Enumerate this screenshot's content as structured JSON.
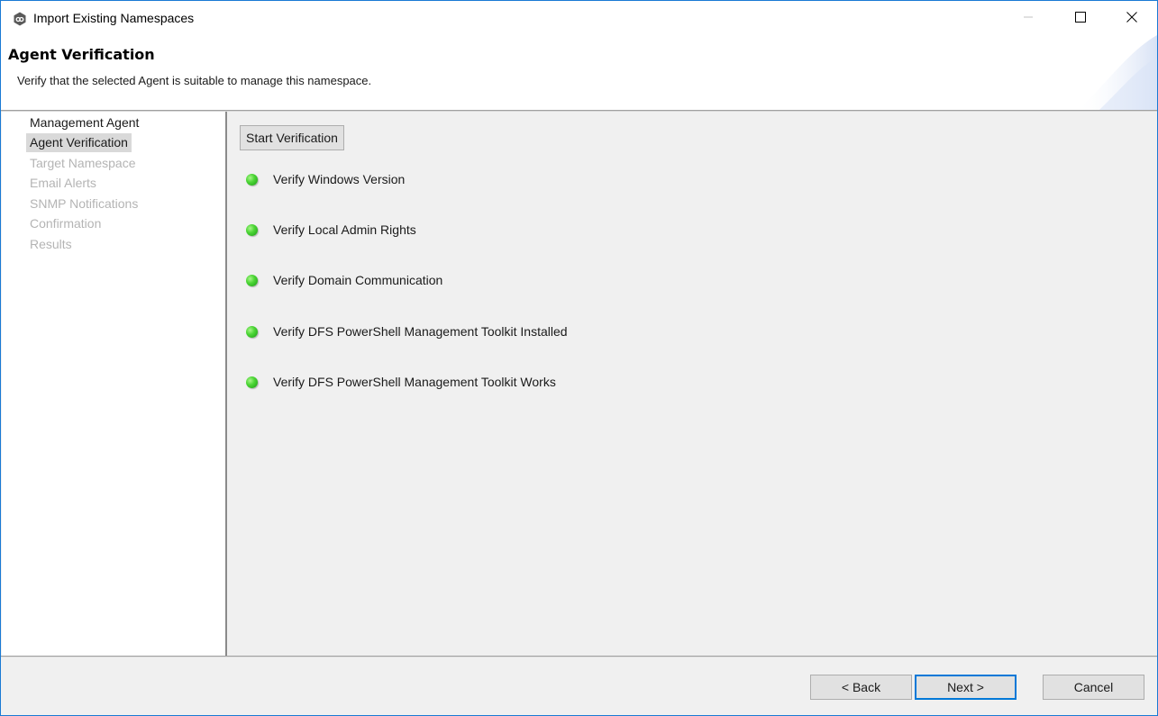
{
  "window": {
    "title": "Import Existing Namespaces",
    "app_icon": "peer-link-icon",
    "controls": {
      "minimize": "minimize-icon",
      "maximize": "maximize-icon",
      "close": "close-icon"
    }
  },
  "header": {
    "title": "Agent Verification",
    "subtitle": "Verify that the selected Agent is suitable to manage this namespace."
  },
  "sidebar": {
    "items": [
      {
        "label": "Management Agent",
        "state": "done"
      },
      {
        "label": "Agent Verification",
        "state": "active"
      },
      {
        "label": "Target Namespace",
        "state": "pending"
      },
      {
        "label": "Email Alerts",
        "state": "pending"
      },
      {
        "label": "SNMP Notifications",
        "state": "pending"
      },
      {
        "label": "Confirmation",
        "state": "pending"
      },
      {
        "label": "Results",
        "state": "pending"
      }
    ]
  },
  "main": {
    "start_button_label": "Start Verification",
    "checks": [
      {
        "label": "Verify Windows Version",
        "status": "success",
        "status_color": "#3cc52a"
      },
      {
        "label": "Verify Local Admin Rights",
        "status": "success",
        "status_color": "#3cc52a"
      },
      {
        "label": "Verify Domain Communication",
        "status": "success",
        "status_color": "#3cc52a"
      },
      {
        "label": "Verify DFS PowerShell Management Toolkit Installed",
        "status": "success",
        "status_color": "#3cc52a"
      },
      {
        "label": "Verify DFS PowerShell Management Toolkit Works",
        "status": "success",
        "status_color": "#3cc52a"
      }
    ]
  },
  "footer": {
    "back_label": "< Back",
    "next_label": "Next >",
    "cancel_label": "Cancel"
  },
  "colors": {
    "accent": "#0078d7",
    "window_border": "#1a7ad4",
    "pending_text": "#b4b4b4"
  }
}
